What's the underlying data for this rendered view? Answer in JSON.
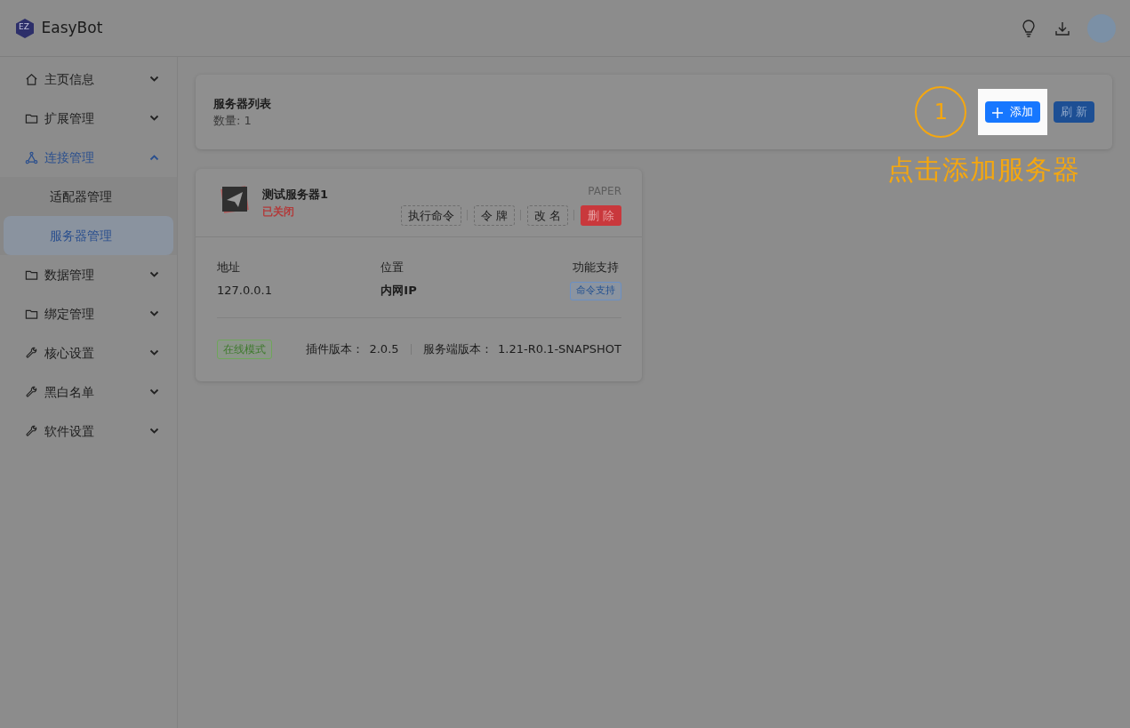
{
  "app": {
    "title": "EasyBot",
    "logo": "EZ"
  },
  "sidebar": {
    "items": [
      {
        "label": "主页信息",
        "kind": "home",
        "expanded": false,
        "selected": false
      },
      {
        "label": "扩展管理",
        "kind": "folder",
        "expanded": false,
        "selected": false
      },
      {
        "label": "连接管理",
        "kind": "network",
        "expanded": true,
        "selected": true,
        "children": [
          {
            "label": "适配器管理",
            "selected": false
          },
          {
            "label": "服务器管理",
            "selected": true
          }
        ]
      },
      {
        "label": "数据管理",
        "kind": "folder",
        "expanded": false,
        "selected": false
      },
      {
        "label": "绑定管理",
        "kind": "folder",
        "expanded": false,
        "selected": false
      },
      {
        "label": "核心设置",
        "kind": "wrench",
        "expanded": false,
        "selected": false
      },
      {
        "label": "黑白名单",
        "kind": "wrench",
        "expanded": false,
        "selected": false
      },
      {
        "label": "软件设置",
        "kind": "wrench",
        "expanded": false,
        "selected": false
      }
    ]
  },
  "list_header": {
    "title": "服务器列表",
    "count": "数量: 1",
    "buttons": [
      {
        "label": "添加",
        "kind": "primary",
        "highlighted": true
      },
      {
        "label": "刷 新",
        "kind": "secondary",
        "highlighted": false
      }
    ]
  },
  "callout": {
    "number": "1",
    "text": "点击添加服务器"
  },
  "servers": [
    {
      "name": "测试服务器1",
      "status": "已关闭",
      "online": false,
      "type": "PAPER",
      "actions": [
        {
          "label": "执行命令",
          "kind": "dashed"
        },
        {
          "label": "令 牌",
          "kind": "dashed"
        },
        {
          "label": "改 名",
          "kind": "dashed"
        },
        {
          "label": "删 除",
          "kind": "danger"
        }
      ],
      "fields": [
        {
          "label": "地址",
          "value": "127.0.0.1",
          "kind": "text"
        },
        {
          "label": "位置",
          "value": "内网IP",
          "kind": "bold"
        },
        {
          "label": "功能支持",
          "value": "命令支持",
          "kind": "tag"
        }
      ],
      "mode": "在线模式",
      "plugin_label": "插件版本：",
      "plugin_version": "2.0.5",
      "server_label": "服务端版本：",
      "server_version": "1.21-R0.1-SNAPSHOT"
    }
  ]
}
